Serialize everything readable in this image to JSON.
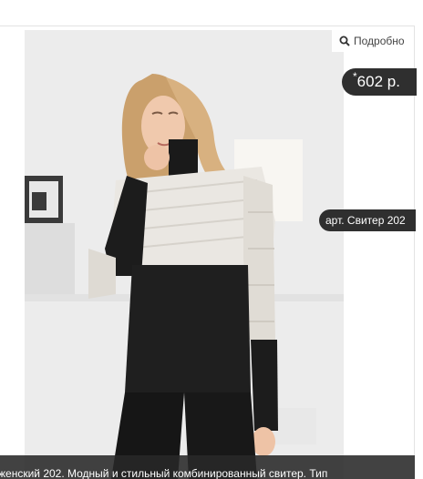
{
  "product": {
    "details_label": "Подробно",
    "details_icon": "search-icon",
    "price_symbol": "*",
    "price_text": "602 р.",
    "article_label": "арт. Свитер 202",
    "caption": "женский 202. Модный и стильный комбинированный свитер. Тип"
  },
  "colors": {
    "badge_bg": "#2f2f2f",
    "badge_text": "#ffffff",
    "caption_bg": "#282828"
  }
}
